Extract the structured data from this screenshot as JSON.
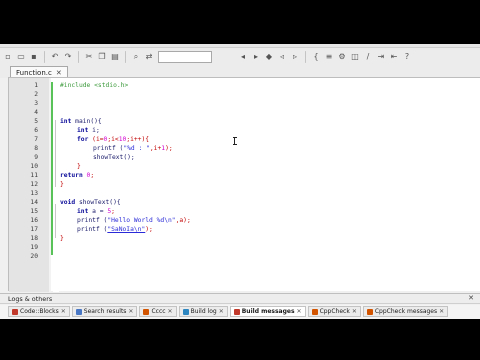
{
  "editor": {
    "file_tab": "Function.c",
    "file_tab_close": "✕",
    "toolbar_combo_value": "",
    "lines": [
      {
        "n": "1"
      },
      {
        "n": "2"
      },
      {
        "n": "3"
      },
      {
        "n": "4"
      },
      {
        "n": "5"
      },
      {
        "n": "6"
      },
      {
        "n": "7"
      },
      {
        "n": "8"
      },
      {
        "n": "9"
      },
      {
        "n": "10"
      },
      {
        "n": "11"
      },
      {
        "n": "12"
      },
      {
        "n": "13"
      },
      {
        "n": "14"
      },
      {
        "n": "15"
      },
      {
        "n": "16"
      },
      {
        "n": "17"
      },
      {
        "n": "18"
      },
      {
        "n": "19"
      },
      {
        "n": "20"
      }
    ],
    "code": {
      "l1": "#include <stdio.h>",
      "l5_kw": "int",
      "l5_rest": " main(){",
      "l6_kw": "int",
      "l6_rest": " i;",
      "l7_kw": "for",
      "l7_a": " (i=",
      "l7_n1": "0",
      "l7_b": ";i<",
      "l7_n2": "10",
      "l7_c": ";i++){",
      "l8_a": "printf (",
      "l8_str": "\"%d : \"",
      "l8_b": ",i+",
      "l8_n": "1",
      "l8_c": ");",
      "l9": "showText();",
      "l10": "}",
      "l11_kw": "return",
      "l11_a": " ",
      "l11_n": "0",
      "l11_b": ";",
      "l12": "}",
      "l14_kw": "void",
      "l14_rest": " showText(){",
      "l15_kw": "int",
      "l15_a": " a = ",
      "l15_n": "5",
      "l15_b": ";",
      "l16_a": "printf (",
      "l16_str": "\"Hello World %d\\n\"",
      "l16_b": ",a);",
      "l17_a": "printf (",
      "l17_str": "\"SaNoIa\\n\"",
      "l17_b": ");",
      "l18": "}"
    }
  },
  "logs": {
    "title": "Logs & others",
    "close": "✕",
    "tabs": [
      {
        "label": "Code::Blocks",
        "icon_color": "#c0392b",
        "icon": "codeblocks-icon"
      },
      {
        "label": "Search results",
        "icon_color": "#4a77c4",
        "icon": "search-icon"
      },
      {
        "label": "Cccc",
        "icon_color": "#d35400",
        "icon": "cccc-icon"
      },
      {
        "label": "Build log",
        "icon_color": "#2e86c1",
        "icon": "gear-icon"
      },
      {
        "label": "Build messages",
        "icon_color": "#c0392b",
        "icon": "pin-icon"
      },
      {
        "label": "CppCheck",
        "icon_color": "#d35400",
        "icon": "check-icon"
      },
      {
        "label": "CppCheck messages",
        "icon_color": "#d35400",
        "icon": "check-icon"
      }
    ],
    "tab_close": "✕"
  }
}
